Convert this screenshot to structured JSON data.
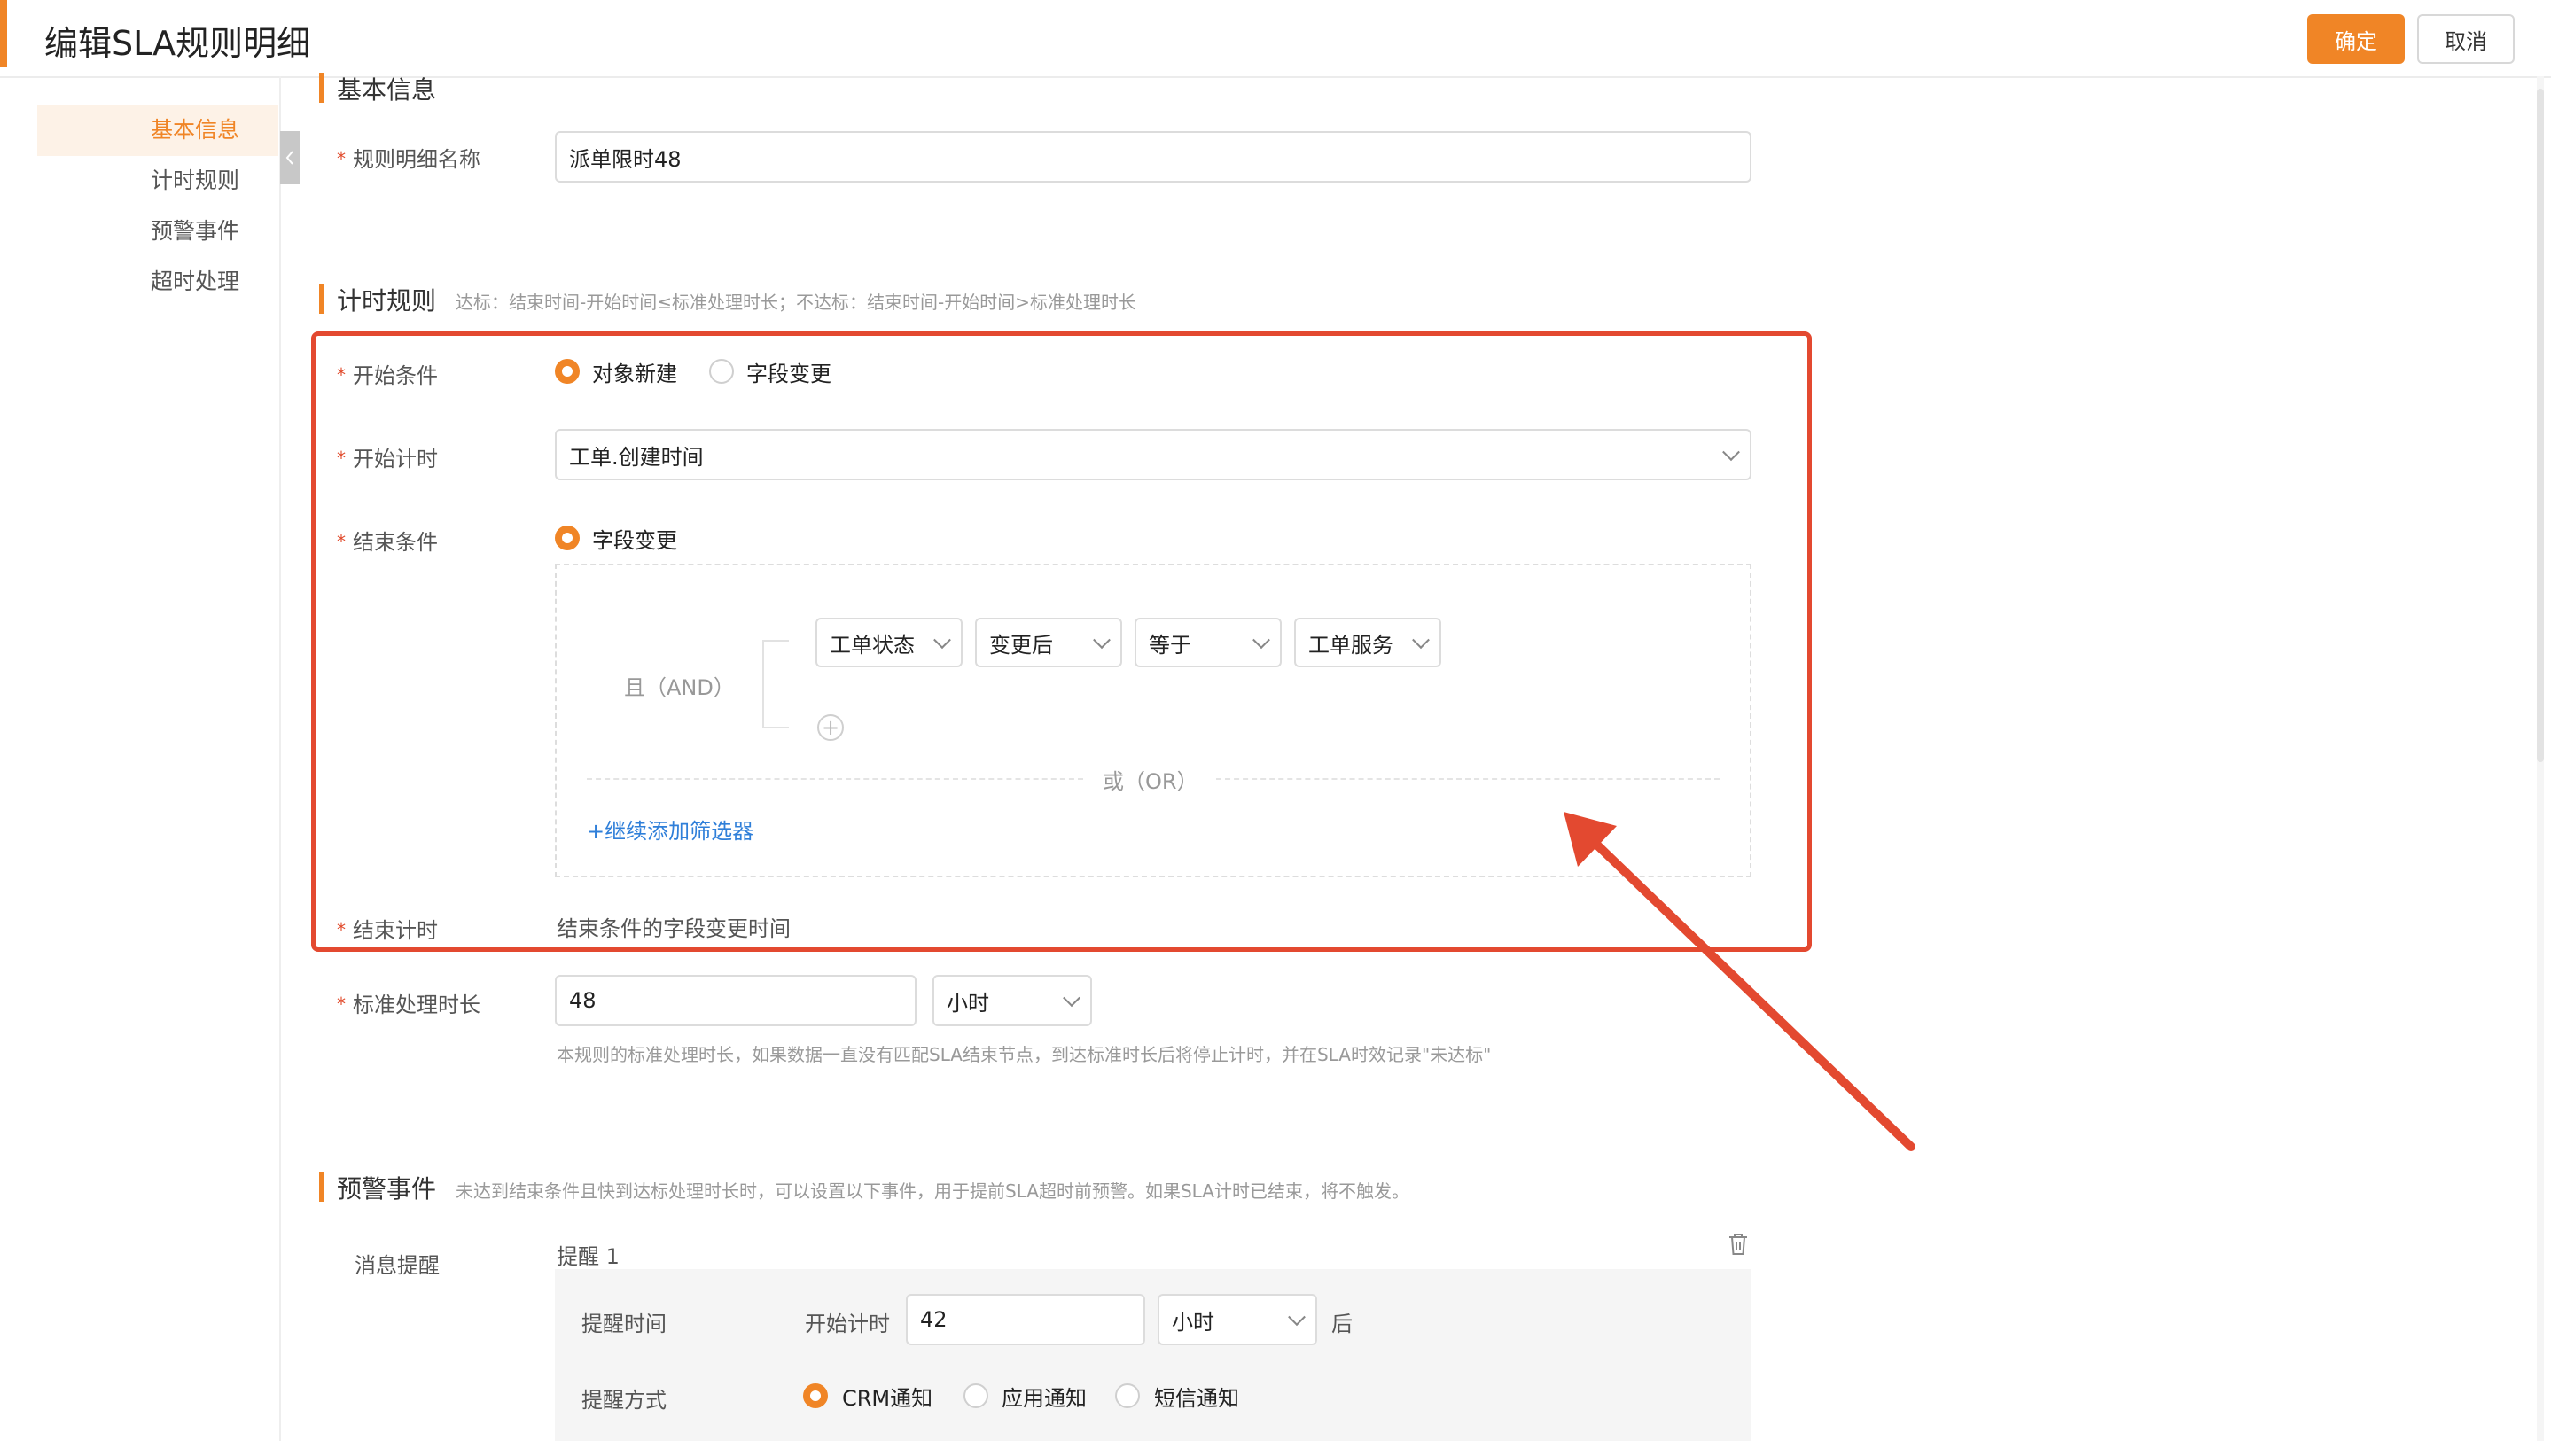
{
  "header": {
    "title": "编辑SLA规则明细",
    "confirm_label": "确定",
    "cancel_label": "取消"
  },
  "sidebar": {
    "items": [
      {
        "label": "基本信息",
        "active": true
      },
      {
        "label": "计时规则",
        "active": false
      },
      {
        "label": "预警事件",
        "active": false
      },
      {
        "label": "超时处理",
        "active": false
      }
    ]
  },
  "basic_info": {
    "section_title": "基本信息",
    "rule_name_label": "规则明细名称",
    "rule_name_value": "派单限时48"
  },
  "timing": {
    "section_title": "计时规则",
    "section_hint": "达标：结束时间-开始时间≤标准处理时长；不达标：结束时间-开始时间>标准处理时长",
    "start_condition_label": "开始条件",
    "start_condition_options": [
      "对象新建",
      "字段变更"
    ],
    "start_timing_label": "开始计时",
    "start_timing_value": "工单.创建时间",
    "end_condition_label": "结束条件",
    "end_condition_option": "字段变更",
    "and_label": "且（AND）",
    "filter_field": "工单状态",
    "filter_change": "变更后",
    "filter_operator": "等于",
    "filter_value": "工单服务",
    "or_label": "或（OR）",
    "add_filter_label": "+继续添加筛选器",
    "end_timing_label": "结束计时",
    "end_timing_value": "结束条件的字段变更时间",
    "duration_label": "标准处理时长",
    "duration_value": "48",
    "duration_unit": "小时",
    "duration_hint": "本规则的标准处理时长，如果数据一直没有匹配SLA结束节点，到达标准时长后将停止计时，并在SLA时效记录\"未达标\""
  },
  "warning": {
    "section_title": "预警事件",
    "section_hint": "未达到结束条件且快到达标处理时长时，可以设置以下事件，用于提前SLA超时前预警。如果SLA计时已结束，将不触发。",
    "message_label": "消息提醒",
    "reminder_title": "提醒 1",
    "reminder_time_label": "提醒时间",
    "reminder_base": "开始计时",
    "reminder_value": "42",
    "reminder_unit": "小时",
    "reminder_suffix": "后",
    "reminder_method_label": "提醒方式",
    "reminder_methods": [
      "CRM通知",
      "应用通知",
      "短信通知"
    ]
  },
  "colors": {
    "accent": "#f08526",
    "highlight_red": "#e34930"
  },
  "icons": {
    "delete": "trash-icon",
    "dropdown": "chevron-down-icon",
    "collapse": "chevron-left-icon",
    "add": "plus-circle-icon"
  }
}
